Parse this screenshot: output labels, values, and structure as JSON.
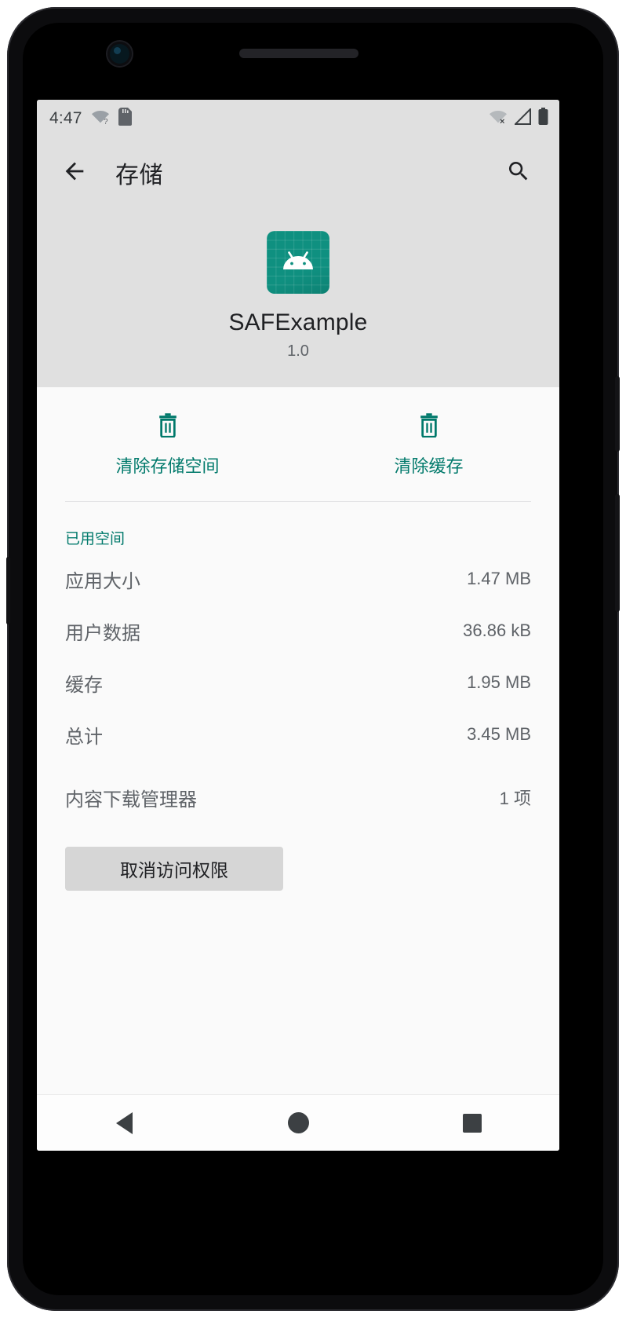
{
  "status_bar": {
    "time": "4:47",
    "left_icons": [
      "wifi-no-internet-icon",
      "sd-card-icon"
    ],
    "right_icons": [
      "wifi-off-icon",
      "cellular-signal-icon",
      "battery-icon"
    ]
  },
  "app_bar": {
    "back_icon": "arrow-back-icon",
    "title": "存储",
    "search_icon": "search-icon"
  },
  "app_header": {
    "icon": "android-app-icon",
    "name": "SAFExample",
    "version": "1.0"
  },
  "actions": [
    {
      "icon": "trash-icon",
      "label": "清除存储空间"
    },
    {
      "icon": "trash-icon",
      "label": "清除缓存"
    }
  ],
  "storage": {
    "section_title": "已用空间",
    "rows": [
      {
        "label": "应用大小",
        "value": "1.47 MB"
      },
      {
        "label": "用户数据",
        "value": "36.86 kB"
      },
      {
        "label": "缓存",
        "value": "1.95 MB"
      },
      {
        "label": "总计",
        "value": "3.45 MB"
      }
    ]
  },
  "downloads": {
    "label": "内容下载管理器",
    "value": "1 项"
  },
  "revoke_button": {
    "label": "取消访问权限"
  },
  "nav_bar": {
    "back": "nav-back-icon",
    "home": "nav-home-icon",
    "recents": "nav-recents-icon"
  },
  "colors": {
    "accent_teal": "#00796b",
    "app_icon_bg": "#0f9080",
    "header_bg": "#e0e0e0",
    "sheet_bg": "#fafafa",
    "text_primary": "#202124",
    "text_secondary": "#5f6368"
  }
}
